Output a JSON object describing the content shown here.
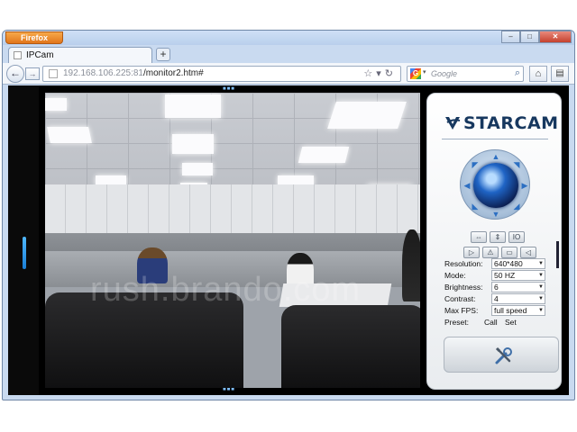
{
  "browser": {
    "app_button": "Firefox",
    "window_controls": [
      "–",
      "□",
      "✕"
    ],
    "tab_title": "IPCam",
    "new_tab": "+",
    "back": "←",
    "forward": "→",
    "url_host": "192.168.106.225:81",
    "url_path": "/monitor2.htm#",
    "search_engine": "G",
    "search_placeholder": "Google",
    "home": "⌂",
    "menu": "▤"
  },
  "camera": {
    "watermark": "rush.brando.com"
  },
  "panel": {
    "brand": "STARCAM",
    "ptz_arrows": [
      "▲",
      "▼",
      "◀",
      "▶",
      "◤",
      "◥",
      "◣",
      "◢"
    ],
    "icon_row_1": [
      "⇔",
      "⇕",
      "IO"
    ],
    "icon_row_2": [
      "▷",
      "⚠",
      "▭",
      "◁"
    ],
    "settings": [
      {
        "label": "Resolution:",
        "value": "640*480"
      },
      {
        "label": "Mode:",
        "value": "50 HZ"
      },
      {
        "label": "Brightness:",
        "value": "6"
      },
      {
        "label": "Contrast:",
        "value": "4"
      },
      {
        "label": "Max FPS:",
        "value": "full speed"
      }
    ],
    "preset_label": "Preset:",
    "preset_call": "Call",
    "preset_set": "Set",
    "accent_color": "#17385f"
  }
}
